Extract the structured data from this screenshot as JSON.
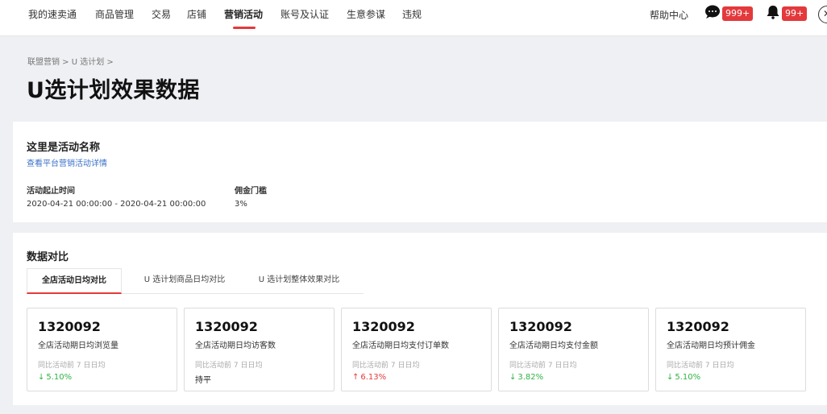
{
  "nav": {
    "items": [
      "我的速卖通",
      "商品管理",
      "交易",
      "店铺",
      "营销活动",
      "账号及认证",
      "生意参谋",
      "违规"
    ],
    "active_index": 4,
    "help": "帮助中心",
    "message_badge": "999+",
    "notification_badge": "99+"
  },
  "breadcrumb": "联盟营销 > U 选计划 >",
  "page_title": "U选计划效果数据",
  "activity": {
    "name": "这里是活动名称",
    "link": "查看平台营销活动详情",
    "time_label": "活动起止时间",
    "time_value": "2020-04-21 00:00:00 - 2020-04-21 00:00:00",
    "commission_label": "佣金门槛",
    "commission_value": "3%"
  },
  "data": {
    "title": "数据对比",
    "tabs": [
      "全店活动日均对比",
      "U 选计划商品日均对比",
      "U 选计划整体效果对比"
    ],
    "active_tab": 0,
    "cards": [
      {
        "value": "1320092",
        "label": "全店活动期日均浏览量",
        "sub": "同比活动前 7 日日均",
        "change": "5.10%",
        "direction": "down"
      },
      {
        "value": "1320092",
        "label": "全店活动期日均访客数",
        "sub": "同比活动前 7 日日均",
        "change": "持平",
        "direction": "flat"
      },
      {
        "value": "1320092",
        "label": "全店活动期日均支付订单数",
        "sub": "同比活动前 7 日日均",
        "change": "6.13%",
        "direction": "up"
      },
      {
        "value": "1320092",
        "label": "全店活动期日均支付金额",
        "sub": "同比活动前 7 日日均",
        "change": "3.82%",
        "direction": "down"
      },
      {
        "value": "1320092",
        "label": "全店活动期日均预计佣金",
        "sub": "同比活动前 7 日日均",
        "change": "5.10%",
        "direction": "down"
      }
    ]
  },
  "colors": {
    "accent": "#e4393c",
    "link": "#3a72c9",
    "up": "#e4393c",
    "down": "#2fb344"
  }
}
